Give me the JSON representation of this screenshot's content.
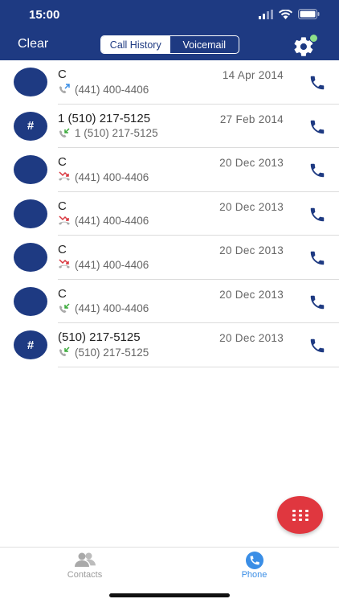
{
  "status": {
    "time": "15:00"
  },
  "nav": {
    "clear_label": "Clear",
    "segments": [
      {
        "label": "Call History",
        "active": true
      },
      {
        "label": "Voicemail",
        "active": false
      }
    ],
    "settings_icon": "gear-icon",
    "notification_dot_color": "#8ee08a"
  },
  "calls": [
    {
      "avatar": "",
      "name": "C",
      "number": "(441) 400-4406",
      "date": "14 Apr 2014",
      "type": "outgoing"
    },
    {
      "avatar": "#",
      "name": "1 (510) 217-5125",
      "number": "1 (510) 217-5125",
      "date": "27 Feb 2014",
      "type": "incoming"
    },
    {
      "avatar": "",
      "name": "C",
      "number": "(441) 400-4406",
      "date": "20 Dec 2013",
      "type": "missed"
    },
    {
      "avatar": "",
      "name": "C",
      "number": "(441) 400-4406",
      "date": "20 Dec 2013",
      "type": "missed"
    },
    {
      "avatar": "",
      "name": "C",
      "number": "(441) 400-4406",
      "date": "20 Dec 2013",
      "type": "missed"
    },
    {
      "avatar": "",
      "name": "C",
      "number": "(441) 400-4406",
      "date": "20 Dec 2013",
      "type": "incoming"
    },
    {
      "avatar": "#",
      "name": "(510) 217-5125",
      "number": "(510) 217-5125",
      "date": "20 Dec 2013",
      "type": "incoming"
    }
  ],
  "tabs": [
    {
      "label": "Contacts",
      "icon": "contacts-icon",
      "active": false
    },
    {
      "label": "Phone",
      "icon": "phone-icon",
      "active": true
    }
  ],
  "colors": {
    "brand": "#1e3a82",
    "fab": "#e0373f",
    "active_tab": "#3a8ee6",
    "inactive_tab": "#9a9a9a",
    "missed": "#d9363e",
    "incoming": "#3aaa3a",
    "outgoing": "#3a8ee6"
  }
}
